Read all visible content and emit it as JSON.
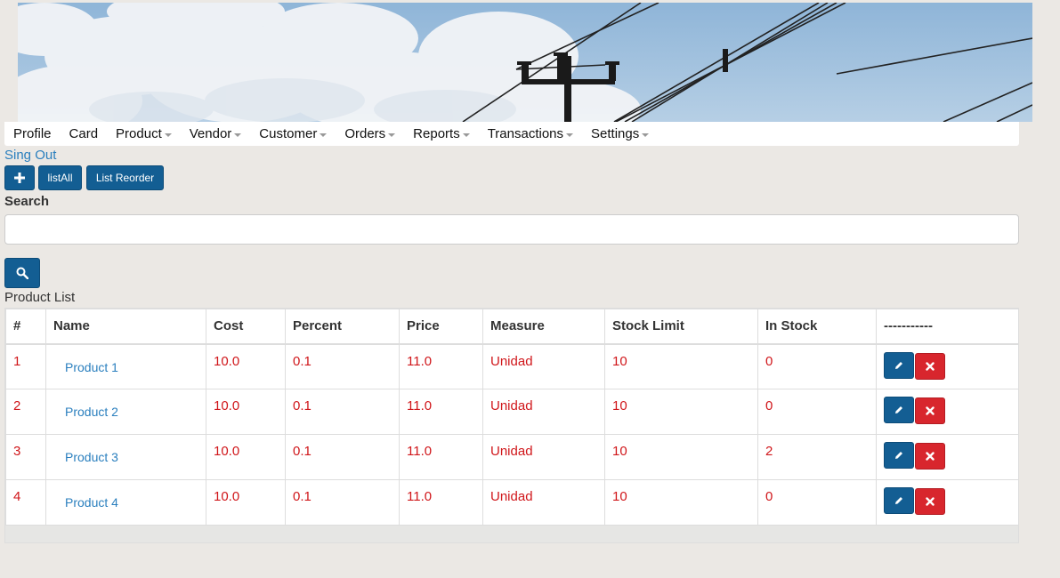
{
  "nav": {
    "items": [
      {
        "label": "Profile",
        "dropdown": false
      },
      {
        "label": "Card",
        "dropdown": false
      },
      {
        "label": "Product",
        "dropdown": true
      },
      {
        "label": "Vendor",
        "dropdown": true
      },
      {
        "label": "Customer",
        "dropdown": true
      },
      {
        "label": "Orders",
        "dropdown": true
      },
      {
        "label": "Reports",
        "dropdown": true
      },
      {
        "label": "Transactions",
        "dropdown": true
      },
      {
        "label": "Settings",
        "dropdown": true
      }
    ]
  },
  "signout_label": "Sing Out",
  "toolbar": {
    "add_icon": "plus-icon",
    "listall_label": "listAll",
    "reorder_label": "List Reorder"
  },
  "search": {
    "label": "Search",
    "value": "",
    "placeholder": "",
    "button_icon": "search-icon"
  },
  "product_list": {
    "title": "Product List",
    "columns": [
      "#",
      "Name",
      "Cost",
      "Percent",
      "Price",
      "Measure",
      "Stock Limit",
      "In Stock",
      "-----------"
    ],
    "rows": [
      {
        "num": "1",
        "name": "Product 1",
        "cost": "10.0",
        "percent": "0.1",
        "price": "11.0",
        "measure": "Unidad",
        "stock_limit": "10",
        "in_stock": "0"
      },
      {
        "num": "2",
        "name": "Product 2",
        "cost": "10.0",
        "percent": "0.1",
        "price": "11.0",
        "measure": "Unidad",
        "stock_limit": "10",
        "in_stock": "0"
      },
      {
        "num": "3",
        "name": "Product 3",
        "cost": "10.0",
        "percent": "0.1",
        "price": "11.0",
        "measure": "Unidad",
        "stock_limit": "10",
        "in_stock": "2"
      },
      {
        "num": "4",
        "name": "Product 4",
        "cost": "10.0",
        "percent": "0.1",
        "price": "11.0",
        "measure": "Unidad",
        "stock_limit": "10",
        "in_stock": "0"
      }
    ],
    "row_actions": {
      "edit_icon": "pencil-icon",
      "delete_icon": "close-icon"
    }
  },
  "colors": {
    "primary": "#135e93",
    "danger": "#d8262d",
    "link": "#2a7fbe",
    "cell_text": "#d0161a",
    "background": "#ebe8e4"
  }
}
